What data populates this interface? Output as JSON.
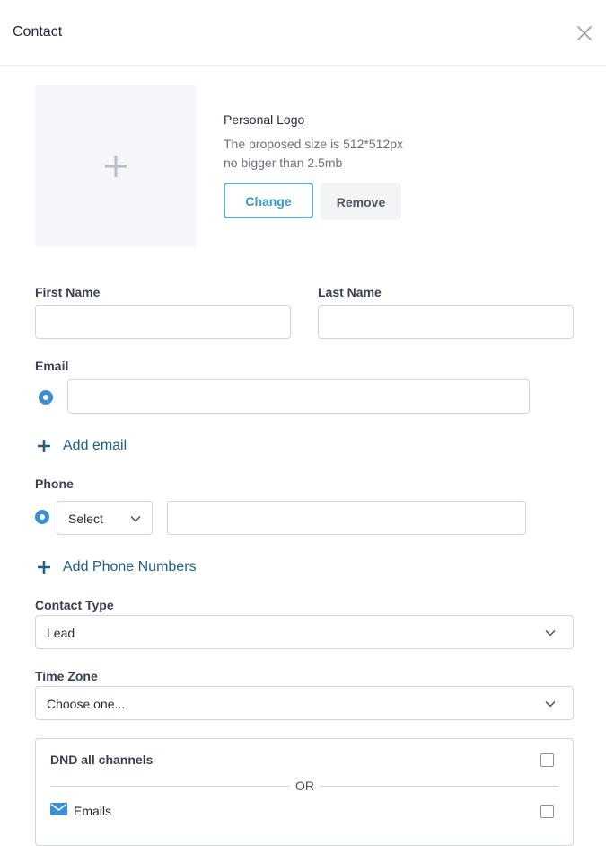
{
  "header": {
    "title": "Contact"
  },
  "logo": {
    "title": "Personal Logo",
    "hint_size": "The proposed size is 512*512px",
    "hint_limit": "no bigger than 2.5mb",
    "change_label": "Change",
    "remove_label": "Remove"
  },
  "form": {
    "first_name_label": "First Name",
    "first_name_value": "",
    "last_name_label": "Last Name",
    "last_name_value": "",
    "email_label": "Email",
    "email_value": "",
    "add_email_label": "Add email",
    "phone_label": "Phone",
    "phone_country_select": "Select",
    "phone_value": "",
    "add_phone_label": "Add Phone Numbers",
    "contact_type_label": "Contact Type",
    "contact_type_value": "Lead",
    "time_zone_label": "Time Zone",
    "time_zone_value": "Choose one..."
  },
  "dnd": {
    "title": "DND all channels",
    "or_label": "OR",
    "emails_label": "Emails"
  },
  "colors": {
    "accent": "#3a9ac7",
    "link": "#1e5f8a",
    "radio": "#3a8fd6"
  }
}
